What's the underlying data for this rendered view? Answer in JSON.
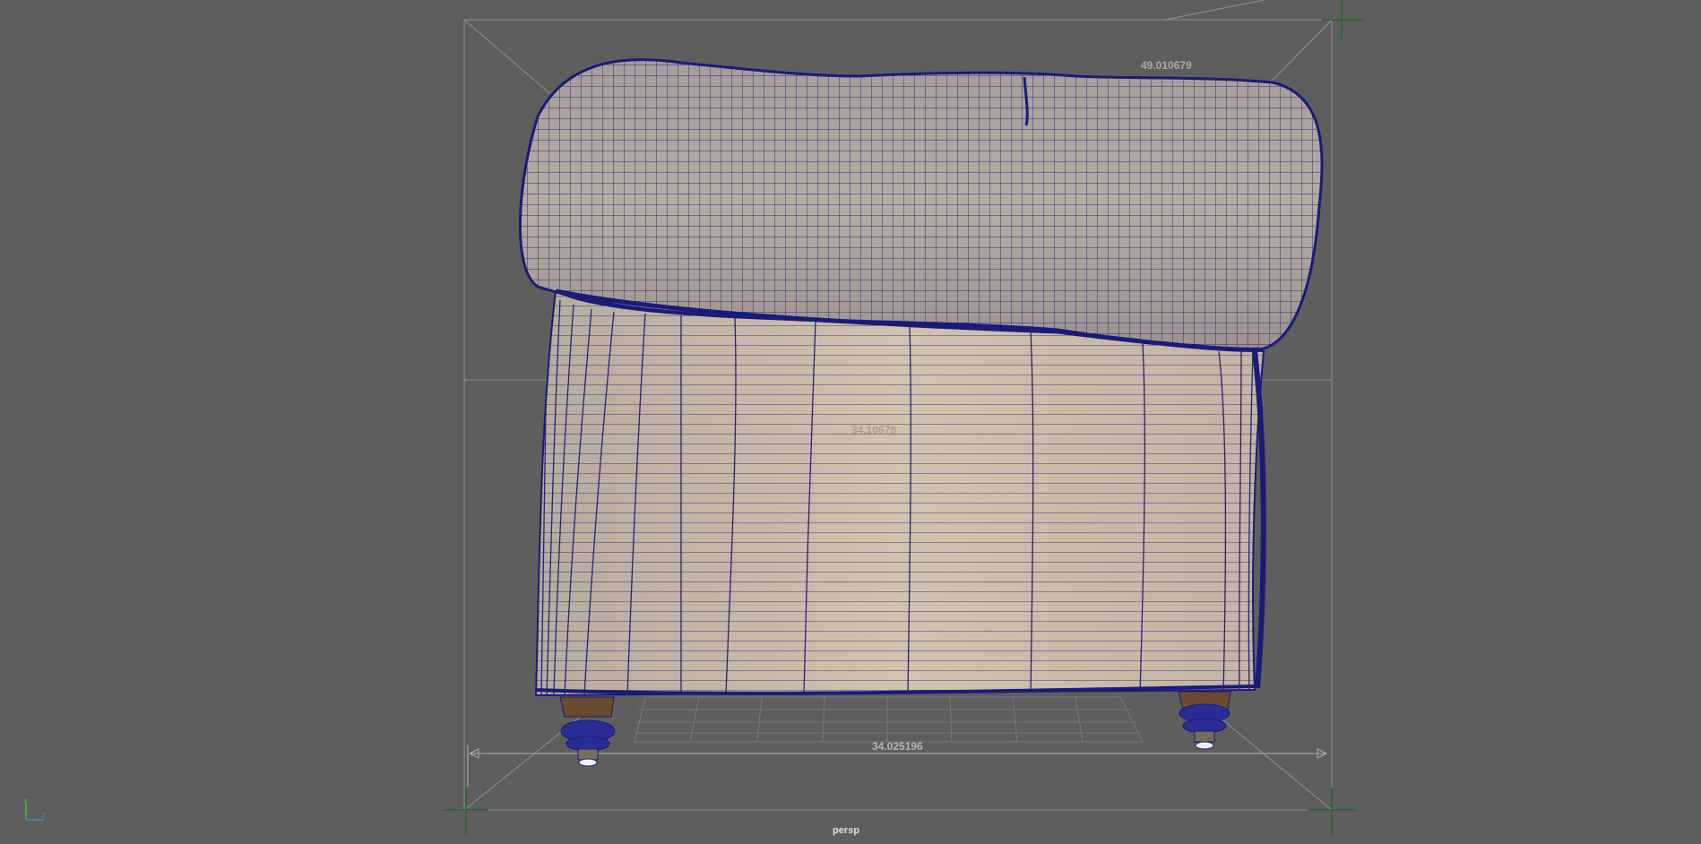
{
  "viewport": {
    "camera_name": "persp",
    "background_color": "#5e5e5e",
    "wireframe_color": "#1e1f7a"
  },
  "dimensions": {
    "top": "49.010679",
    "middle": "34.10678",
    "bottom": "34.025196"
  },
  "axis": {
    "y_label": "Y",
    "z_label": "Z"
  },
  "model": {
    "object": "armchair",
    "view": "side",
    "fabric_color": "#c9b9a6",
    "leg_color": "#6b4a2f"
  }
}
